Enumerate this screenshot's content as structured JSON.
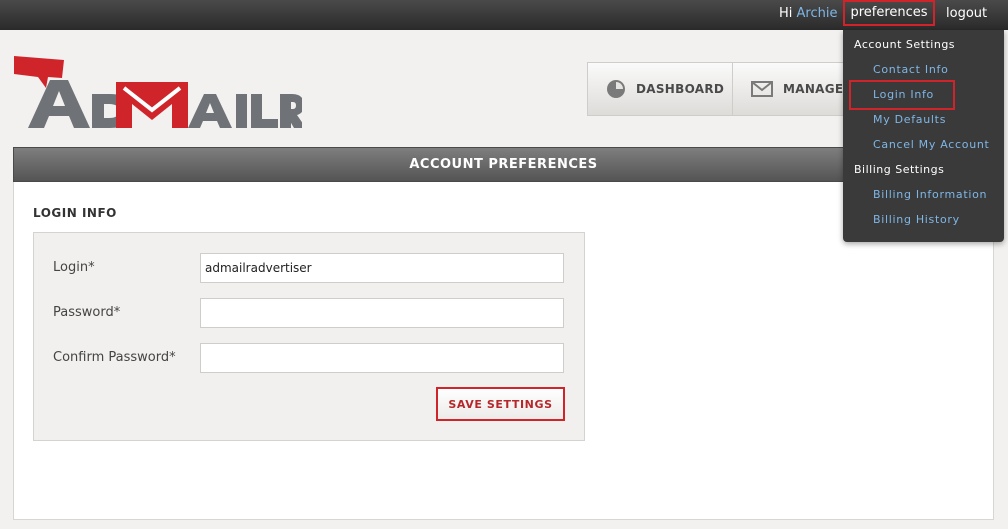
{
  "topbar": {
    "greeting": "Hi",
    "user_name": "Archie",
    "preferences_label": "preferences",
    "logout_label": "logout"
  },
  "logo": {
    "text": "ADMAILR"
  },
  "nav": {
    "dashboard_label": "DASHBOARD",
    "manage_label": "MANAGE"
  },
  "header": {
    "title": "ACCOUNT PREFERENCES"
  },
  "login_section": {
    "title": "LOGIN INFO",
    "login_label": "Login*",
    "login_value": "admailradvertiser",
    "password_label": "Password*",
    "password_value": "",
    "confirm_label": "Confirm Password*",
    "confirm_value": "",
    "save_label": "SAVE SETTINGS"
  },
  "dropdown": {
    "account_heading": "Account Settings",
    "contact_info": "Contact Info",
    "login_info": "Login Info",
    "my_defaults": "My Defaults",
    "cancel_account": "Cancel My Account",
    "billing_heading": "Billing Settings",
    "billing_information": "Billing Information",
    "billing_history": "Billing History"
  },
  "colors": {
    "accent_red": "#d0242b",
    "link_blue": "#7fb6e6",
    "topbar": "#2a2a2a"
  }
}
